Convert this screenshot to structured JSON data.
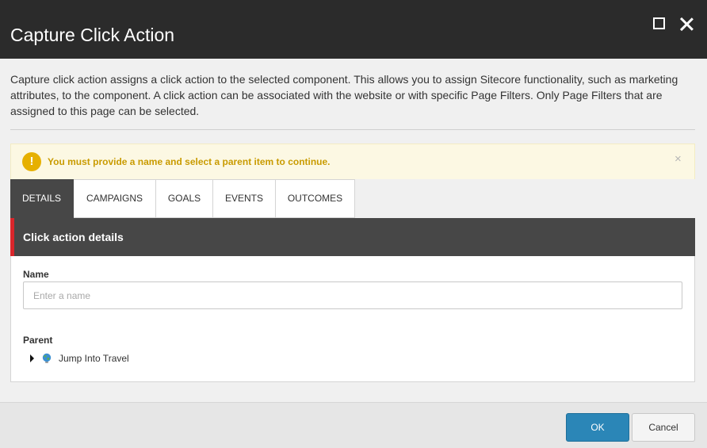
{
  "dialog": {
    "title": "Capture Click Action",
    "description": "Capture click action assigns a click action to the selected component. This allows you to assign Sitecore functionality, such as marketing attributes, to the component. A click action can be associated with the website or with specific Page Filters. Only Page Filters that are assigned to this page can be selected.",
    "window_controls": {
      "maximize_icon": "maximize-icon",
      "close_icon": "close-icon"
    }
  },
  "alert": {
    "icon": "warning-icon",
    "icon_glyph": "!",
    "message": "You must provide a name and select a parent item to continue.",
    "close_glyph": "×",
    "color": "#c99b00"
  },
  "tabs": [
    {
      "label": "DETAILS",
      "active": true
    },
    {
      "label": "CAMPAIGNS",
      "active": false
    },
    {
      "label": "GOALS",
      "active": false
    },
    {
      "label": "EVENTS",
      "active": false
    },
    {
      "label": "OUTCOMES",
      "active": false
    }
  ],
  "panel": {
    "header": "Click action details",
    "name": {
      "label": "Name",
      "value": "",
      "placeholder": "Enter a name"
    },
    "parent": {
      "label": "Parent",
      "tree": [
        {
          "label": "Jump Into Travel",
          "icon": "globe-icon",
          "expanded": false
        }
      ]
    }
  },
  "footer": {
    "ok_label": "OK",
    "cancel_label": "Cancel"
  },
  "colors": {
    "titlebar": "#2b2b2b",
    "accent": "#2b86b7",
    "header_accent": "#d9262b"
  }
}
